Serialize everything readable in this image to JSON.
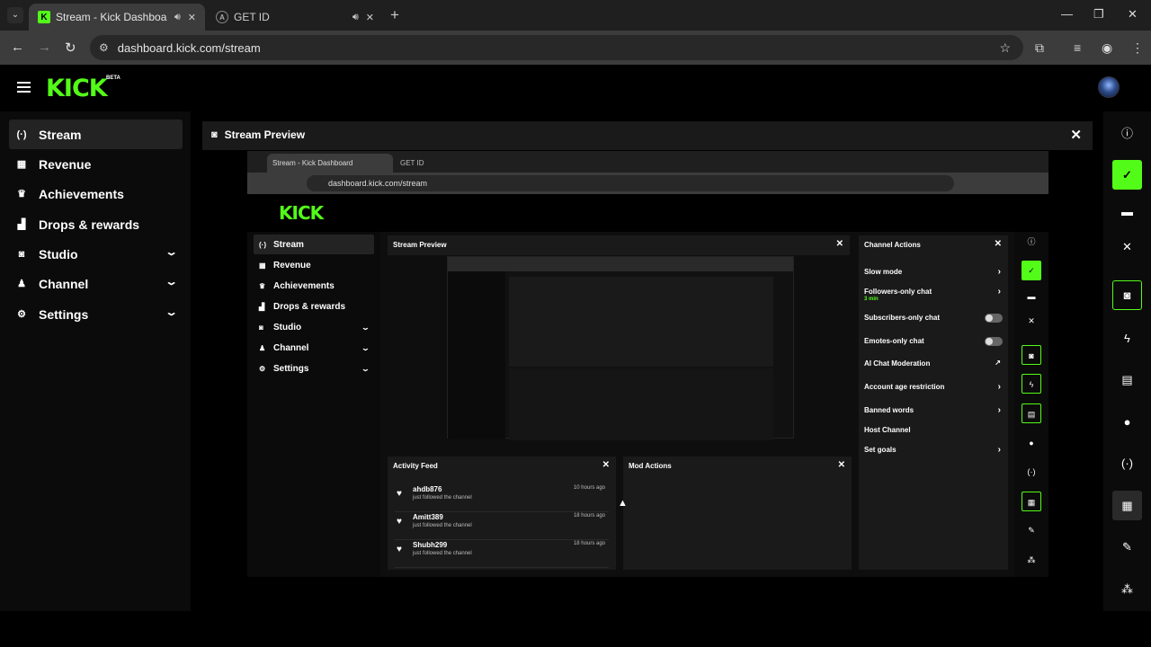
{
  "browser": {
    "tabs": [
      {
        "title": "Stream - Kick Dashboard",
        "active": true
      },
      {
        "title": "GET ID",
        "active": false
      }
    ],
    "url": "dashboard.kick.com/stream"
  },
  "kick": {
    "logo": "KICK",
    "beta": "BETA",
    "sidebar": [
      {
        "label": "Stream",
        "icon": "broadcast-icon",
        "glyph": "(·)",
        "active": true
      },
      {
        "label": "Revenue",
        "icon": "revenue-icon",
        "glyph": "▦"
      },
      {
        "label": "Achievements",
        "icon": "trophy-icon",
        "glyph": "♛"
      },
      {
        "label": "Drops & rewards",
        "icon": "drops-icon",
        "glyph": "▟"
      },
      {
        "label": "Studio",
        "icon": "studio-icon",
        "glyph": "◙",
        "chevron": true
      },
      {
        "label": "Channel",
        "icon": "channel-icon",
        "glyph": "♟",
        "chevron": true
      },
      {
        "label": "Settings",
        "icon": "settings-icon",
        "glyph": "⚙",
        "chevron": true
      }
    ],
    "stream_preview": {
      "title": "Stream Preview"
    },
    "embedded": {
      "tabs": [
        "Stream - Kick Dashboard",
        "GET ID"
      ],
      "url": "dashboard.kick.com/stream",
      "stream_preview_title": "Stream Preview",
      "activity_feed": {
        "title": "Activity Feed",
        "items": [
          {
            "name": "ahdb876",
            "sub": "just followed the channel",
            "time": "10 hours ago"
          },
          {
            "name": "Amitt389",
            "sub": "just followed the channel",
            "time": "18 hours ago"
          },
          {
            "name": "Shubh299",
            "sub": "just followed the channel",
            "time": "18 hours ago"
          }
        ]
      },
      "mod_actions": {
        "title": "Mod Actions"
      },
      "channel_actions": {
        "title": "Channel Actions",
        "items": [
          {
            "label": "Slow mode",
            "type": "arrow"
          },
          {
            "label": "Followers-only chat",
            "sub": "3 min",
            "type": "arrow"
          },
          {
            "label": "Subscribers-only chat",
            "type": "toggle"
          },
          {
            "label": "Emotes-only chat",
            "type": "toggle"
          },
          {
            "label": "AI Chat Moderation",
            "type": "external"
          },
          {
            "label": "Account age restriction",
            "type": "arrow"
          },
          {
            "label": "Banned words",
            "type": "arrow"
          },
          {
            "label": "Host Channel",
            "type": "none"
          },
          {
            "label": "Set goals",
            "type": "arrow"
          }
        ]
      }
    },
    "accent": "#53fc18"
  }
}
